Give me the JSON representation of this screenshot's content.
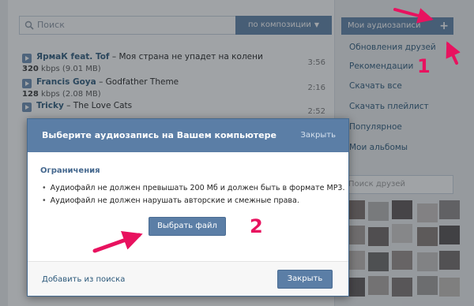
{
  "search": {
    "placeholder": "Поиск",
    "filter_label": "по композиции",
    "filter_icon": "chevron-down-icon"
  },
  "tracks": [
    {
      "artist": "ЯрмаК feat. Tof",
      "sep": " – ",
      "song": "Моя страна не упадет на колени",
      "meta_bold": "320",
      "meta_rest": " kbps (9.01 MB)",
      "duration": "3:56"
    },
    {
      "artist": "Francis Goya",
      "sep": " – ",
      "song": "Godfather Theme",
      "meta_bold": "128",
      "meta_rest": " kbps (2.08 MB)",
      "duration": "2:16"
    },
    {
      "artist": "Tricky",
      "sep": " – ",
      "song": "The Love Cats",
      "meta_bold": "",
      "meta_rest": "",
      "duration": "2:52"
    }
  ],
  "sidebar": {
    "header": "Мои аудиозаписи",
    "add_icon": "plus-icon",
    "items": [
      "Обновления друзей",
      "Рекомендации",
      "Скачать все",
      "Скачать плейлист",
      "Популярное",
      "Мои альбомы"
    ],
    "friends_placeholder": "Поиск друзей"
  },
  "modal": {
    "title": "Выберите аудиозапись на Вашем компьютере",
    "close_top": "Закрыть",
    "limits_title": "Ограничения",
    "bullets": [
      "Аудиофайл не должен превышать 200 Мб и должен быть в формате MP3.",
      "Аудиофайл не должен нарушать авторские и смежные права."
    ],
    "choose_button": "Выбрать файл",
    "add_from_search": "Добавить из поиска",
    "close_button": "Закрыть"
  },
  "annotations": {
    "step1": "1",
    "step2": "2",
    "color": "#e8125f"
  }
}
